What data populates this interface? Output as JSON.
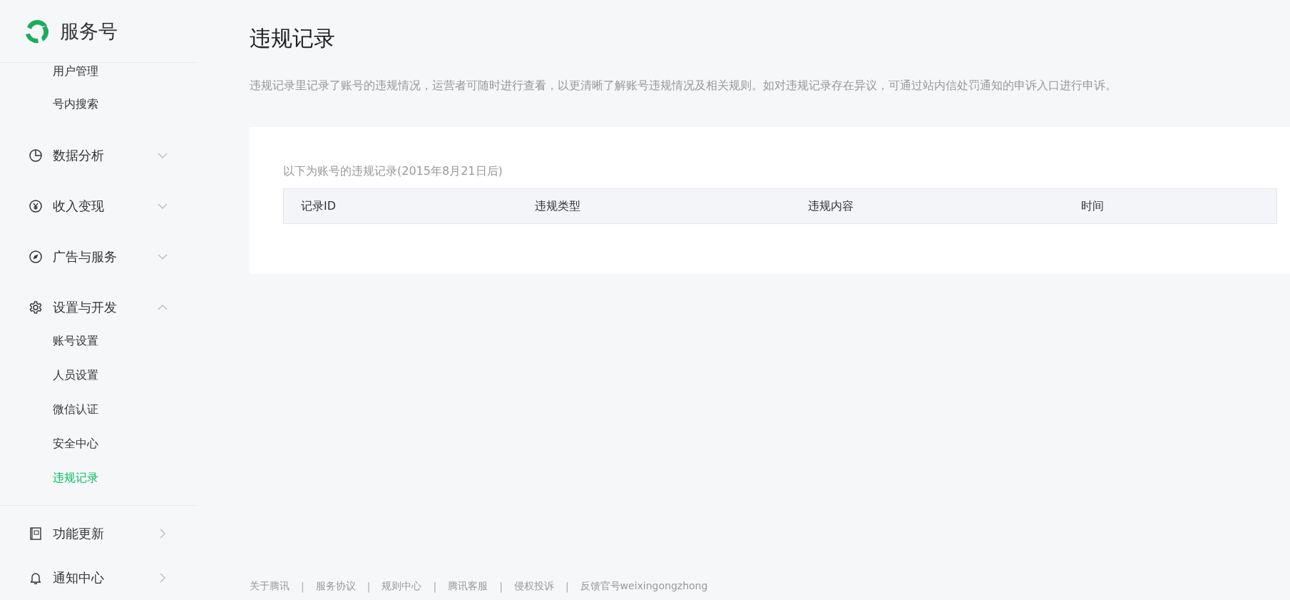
{
  "brand": {
    "name": "服务号"
  },
  "sidebar": {
    "top_items": [
      {
        "kind": "sub",
        "label": "用户管理",
        "selected": false
      },
      {
        "kind": "sub",
        "label": "号内搜索",
        "selected": false
      },
      {
        "kind": "group",
        "label": "数据分析",
        "expanded": false
      },
      {
        "kind": "group",
        "label": "收入变现",
        "expanded": false
      },
      {
        "kind": "group",
        "label": "广告与服务",
        "expanded": false
      },
      {
        "kind": "group",
        "label": "设置与开发",
        "expanded": true
      },
      {
        "kind": "sub",
        "label": "账号设置",
        "selected": false
      },
      {
        "kind": "sub",
        "label": "人员设置",
        "selected": false
      },
      {
        "kind": "sub",
        "label": "微信认证",
        "selected": false
      },
      {
        "kind": "sub",
        "label": "安全中心",
        "selected": false
      },
      {
        "kind": "sub",
        "label": "违规记录",
        "selected": true
      }
    ],
    "bottom_items": [
      {
        "label": "功能更新"
      },
      {
        "label": "通知中心"
      }
    ]
  },
  "page": {
    "title": "违规记录",
    "description": "违规记录里记录了账号的违规情况，运营者可随时进行查看，以更清晰了解账号违规情况及相关规则。如对违规记录存在异议，可通过站内信处罚通知的申诉入口进行申诉。"
  },
  "card": {
    "caption": "以下为账号的违规记录(2015年8月21日后)",
    "table": {
      "columns": [
        "记录ID",
        "违规类型",
        "违规内容",
        "时间"
      ]
    }
  },
  "footer": {
    "links": [
      "关于腾讯",
      "服务协议",
      "规则中心",
      "腾讯客服",
      "侵权投诉",
      "反馈官号weixingongzhong"
    ],
    "separator": "|"
  }
}
